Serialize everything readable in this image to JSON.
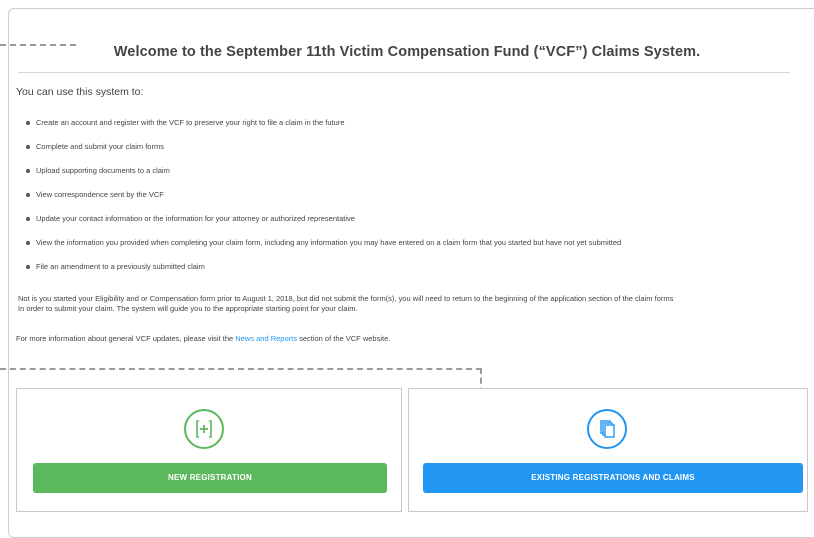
{
  "header": {
    "title": "Welcome to the September 11th Victim Compensation Fund (“VCF”) Claims System."
  },
  "intro": "You can use this system to:",
  "bullets": [
    "Create an account and register with the VCF to preserve your right to file a claim in the future",
    "Complete and submit your claim forms",
    "Upload supporting documents to a claim",
    "View correspondence sent by the VCF",
    "Update your contact information or the information for your attorney or authorized representative",
    "View the information you provided when completing your claim form, including any information you may have entered on a claim form that you started but have not yet submitted",
    "File an amendment to a previously submitted claim"
  ],
  "note": {
    "line1": "Not is you started your Eligibility and or Compensation form prior to August 1, 2018, but did not submit the form(s), you will need to return to the beginning of the application section of the claim forms",
    "line2": "In order to submit your claim. The system will guide you to the appropriate starting point for your claim."
  },
  "more_info": {
    "prefix": "For more information about general VCF updates, please visit the ",
    "link": "News and Reports",
    "suffix": " section of the VCF website."
  },
  "cards": {
    "new_registration": {
      "label": "NEW REGISTRATION",
      "icon": "plus-document-icon",
      "color": "#5cb85c"
    },
    "existing": {
      "label": "EXISTING REGISTRATIONS AND CLAIMS",
      "icon": "documents-stack-icon",
      "color": "#2196f3"
    }
  }
}
